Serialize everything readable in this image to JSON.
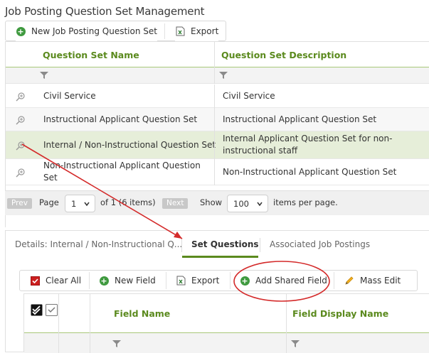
{
  "page": {
    "title": "Job Posting Question Set Management"
  },
  "top_toolbar": {
    "new_label": "New Job Posting Question Set",
    "export_label": "Export"
  },
  "grid": {
    "columns": [
      "Question Set Name",
      "Question Set Description"
    ],
    "rows": [
      {
        "name": "Civil Service",
        "description": "Civil Service"
      },
      {
        "name": "Instructional Applicant Question Set",
        "description": "Instructional Applicant Question Set"
      },
      {
        "name": "Internal / Non-Instructional Question Set",
        "description": "Internal Applicant Question Set for non-instructional staff",
        "selected": true
      },
      {
        "name": "Non-Instructional Applicant Question Set",
        "description": "Non-Instructional Applicant Question Set"
      }
    ]
  },
  "pager": {
    "prev_label": "Prev",
    "page_label": "Page",
    "page_value": "1",
    "of_text": "of 1 (6 items)",
    "next_label": "Next",
    "show_label": "Show",
    "per_page_value": "100",
    "per_page_suffix": "items per page."
  },
  "details": {
    "tabs": [
      {
        "label": "Details: Internal / Non-Instructional Q...",
        "active": false
      },
      {
        "label": "Set Questions",
        "active": true
      },
      {
        "label": "Associated Job Postings",
        "active": false
      }
    ]
  },
  "toolbar2": {
    "clear_all_label": "Clear All",
    "new_field_label": "New Field",
    "export_label": "Export",
    "add_shared_field_label": "Add Shared Field",
    "mass_edit_label": "Mass Edit"
  },
  "grid2": {
    "columns": [
      "Field Name",
      "Field Display Name"
    ]
  },
  "colors": {
    "accent_green": "#5b8a1e",
    "selected_row": "#e6eed9",
    "annotation_red": "#d42a2a",
    "plus_green": "#3f9a3f"
  }
}
